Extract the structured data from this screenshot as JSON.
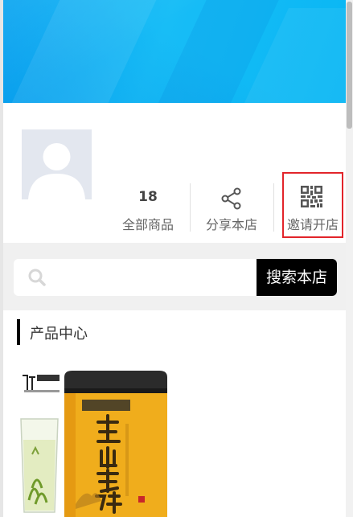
{
  "shop": {
    "stats": {
      "goods_count": "18",
      "goods_label": "全部商品"
    },
    "actions": {
      "share_label": "分享本店",
      "invite_label": "邀请开店"
    },
    "highlight_color": "#e2242a",
    "banner_color": "#0ab3f3"
  },
  "search": {
    "placeholder": "",
    "button_label": "搜索本店"
  },
  "section": {
    "title": "产品中心"
  },
  "product": {
    "image_alt": "黄山毛峰",
    "brand_text": "黄山毛峰"
  },
  "icons": [
    "search-icon",
    "share-icon",
    "qrcode-icon",
    "avatar-placeholder-icon"
  ]
}
